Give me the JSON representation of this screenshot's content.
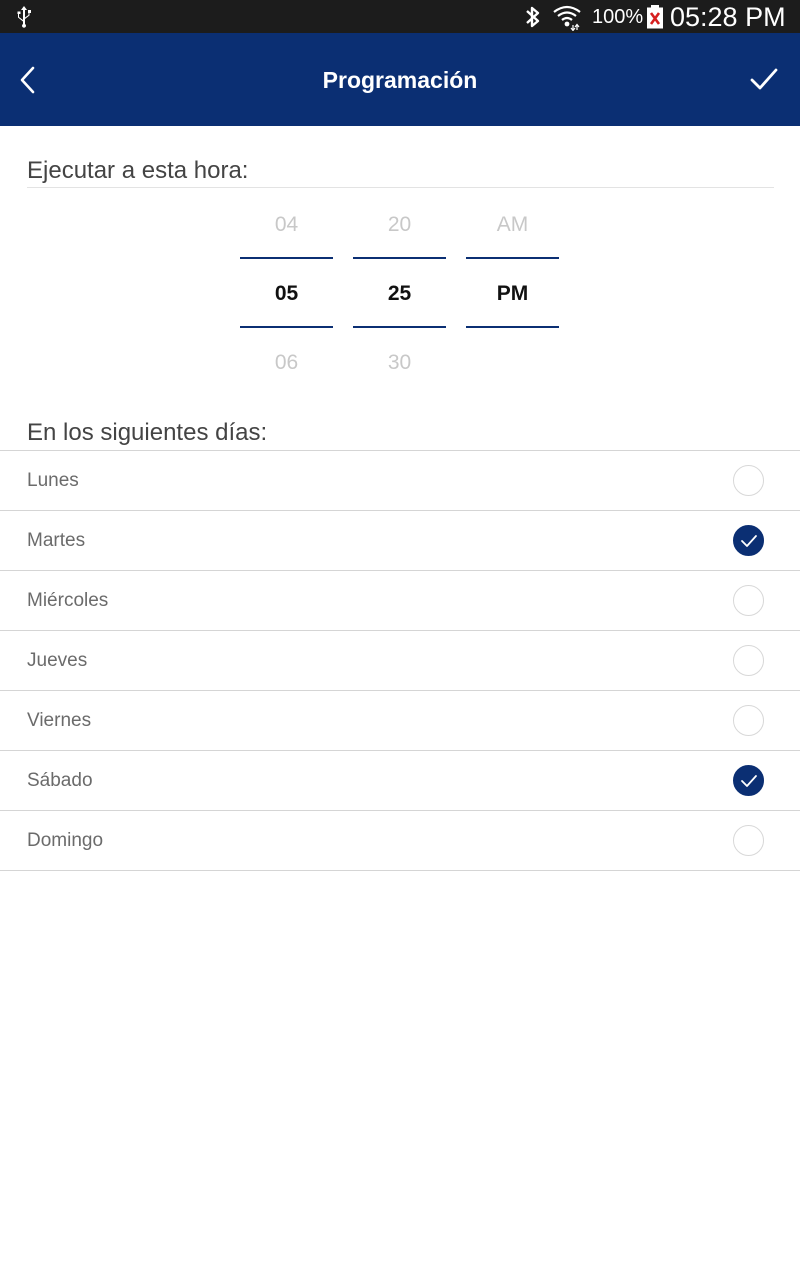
{
  "status_bar": {
    "battery_percent": "100%",
    "time": "05:28 PM",
    "icons": [
      "usb-icon",
      "bluetooth-icon",
      "wifi-icon",
      "battery-icon"
    ]
  },
  "toolbar": {
    "title": "Programación",
    "back_icon": "chevron-left-icon",
    "confirm_icon": "check-icon",
    "background": "#0b2f73"
  },
  "time_section": {
    "heading": "Ejecutar a esta hora:",
    "hour": {
      "prev": "04",
      "selected": "05",
      "next": "06"
    },
    "minute": {
      "prev": "20",
      "selected": "25",
      "next": "30"
    },
    "ampm": {
      "prev": "AM",
      "selected": "PM",
      "next": ""
    }
  },
  "days_section": {
    "heading": "En los siguientes días:",
    "days": [
      {
        "label": "Lunes",
        "checked": false
      },
      {
        "label": "Martes",
        "checked": true
      },
      {
        "label": "Miércoles",
        "checked": false
      },
      {
        "label": "Jueves",
        "checked": false
      },
      {
        "label": "Viernes",
        "checked": false
      },
      {
        "label": "Sábado",
        "checked": true
      },
      {
        "label": "Domingo",
        "checked": false
      }
    ]
  },
  "colors": {
    "accent": "#0b2f73",
    "status_bar": "#1c1c1c"
  }
}
